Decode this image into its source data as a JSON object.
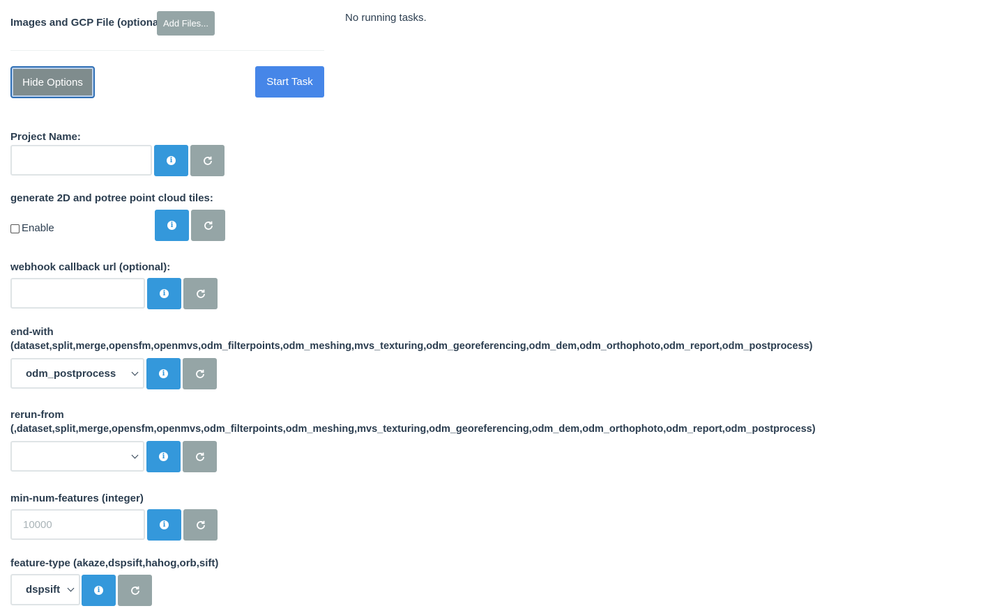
{
  "upload": {
    "label": "Images and GCP File (optional):",
    "add_files": "Add Files..."
  },
  "status": {
    "text": "No running tasks."
  },
  "actions": {
    "hide_options": "Hide Options",
    "start_task": "Start Task"
  },
  "options": {
    "project_name": {
      "label": "Project Name:",
      "value": ""
    },
    "tiles": {
      "label": "generate 2D and potree point cloud tiles:",
      "checkbox_label": "Enable"
    },
    "webhook": {
      "label": "webhook callback url (optional):",
      "value": ""
    },
    "end_with": {
      "label_line1": "end-with",
      "label_line2": "(dataset,split,merge,opensfm,openmvs,odm_filterpoints,odm_meshing,mvs_texturing,odm_georeferencing,odm_dem,odm_orthophoto,odm_report,odm_postprocess)",
      "selected": "odm_postprocess"
    },
    "rerun_from": {
      "label_line1": "rerun-from",
      "label_line2": "(,dataset,split,merge,opensfm,openmvs,odm_filterpoints,odm_meshing,mvs_texturing,odm_georeferencing,odm_dem,odm_orthophoto,odm_report,odm_postprocess)",
      "selected": ""
    },
    "min_num_features": {
      "label": "min-num-features (integer)",
      "placeholder": "10000"
    },
    "feature_type": {
      "label": "feature-type (akaze,dspsift,hahog,orb,sift)",
      "selected": "dspsift"
    }
  },
  "icons": {
    "info": "info-circle-icon",
    "reset": "refresh-icon"
  },
  "colors": {
    "primary": "#4686e8",
    "info": "#3498db",
    "gray": "#95a5a6",
    "dark_gray": "#7f8c8d"
  }
}
